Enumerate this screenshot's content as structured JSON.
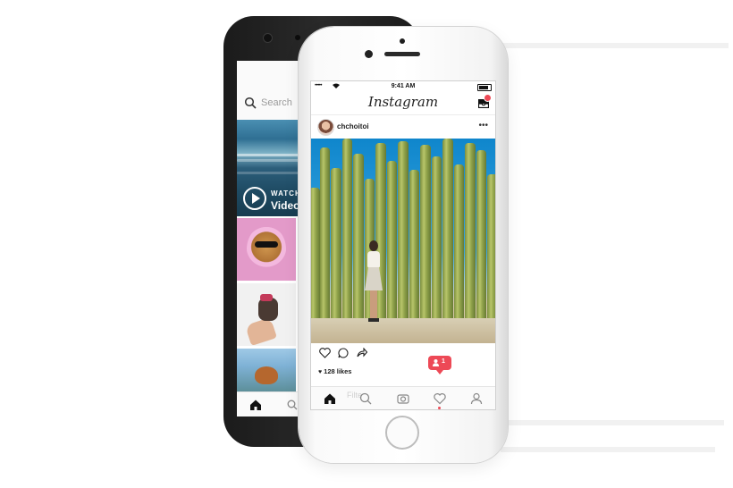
{
  "back_phone": {
    "search_placeholder": "Search",
    "explore_video": {
      "watch_label": "WATCH",
      "video_label": "Video"
    },
    "icons": [
      "search-icon",
      "play-icon",
      "home-icon",
      "search-tab-icon"
    ]
  },
  "front_phone": {
    "status_bar": {
      "signal": "•••••",
      "time": "9:41 AM"
    },
    "header": {
      "app_name": "Instagram"
    },
    "post": {
      "username": "chchoitoi",
      "more": "•••",
      "likes": "128 likes"
    },
    "notification": {
      "count": "1"
    },
    "tabbar": {
      "ghost_label": "Filte"
    },
    "icons": [
      "wifi-icon",
      "battery-icon",
      "inbox-icon",
      "like-icon",
      "comment-icon",
      "share-icon",
      "home-icon",
      "search-icon",
      "camera-icon",
      "activity-icon",
      "profile-icon"
    ]
  },
  "colors": {
    "notification_red": "#ed4956",
    "sky_blue": "#0f86cc"
  }
}
